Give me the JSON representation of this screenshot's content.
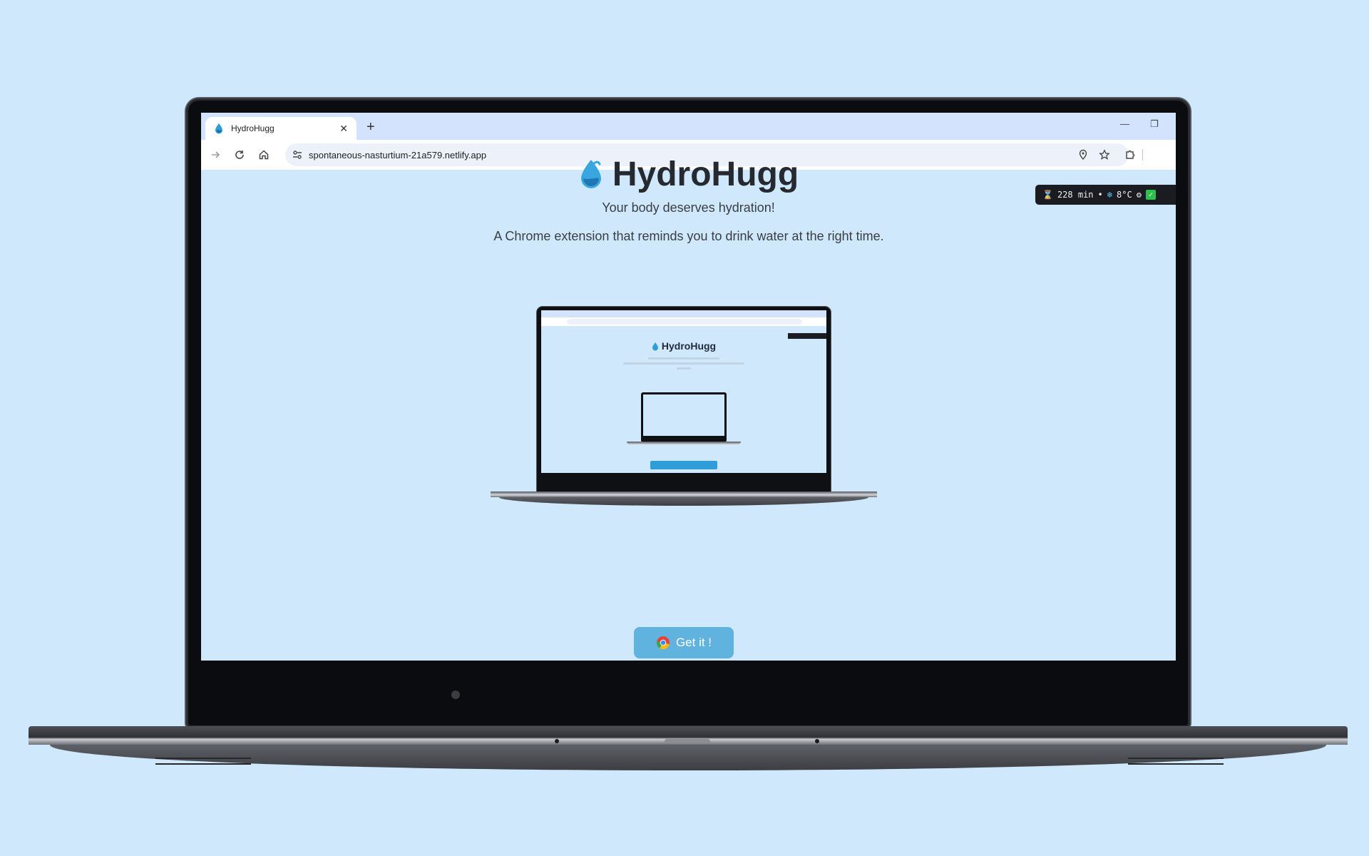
{
  "browser": {
    "tab_title": "HydroHugg",
    "url": "spontaneous-nasturtium-21a579.netlify.app"
  },
  "extension_widget": {
    "timer": "228 min",
    "separator": "•",
    "temperature": "8°C"
  },
  "page": {
    "title": "HydroHugg",
    "subtitle": "Your body deserves hydration!",
    "description": "A Chrome extension that reminds you to drink water at the right time.",
    "cta_label": "Get it !",
    "preview_title": "HydroHugg"
  },
  "icons": {
    "logo": "water-drop-icon",
    "cta": "chrome-icon"
  },
  "colors": {
    "background": "#d0e8fb",
    "accent": "#5fb3de",
    "title": "#262a30"
  }
}
